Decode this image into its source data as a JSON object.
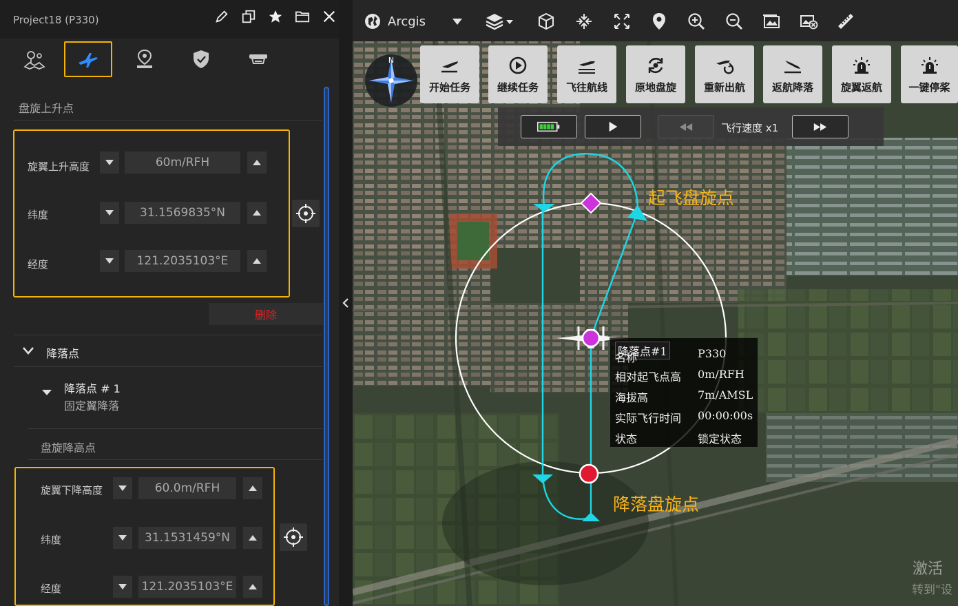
{
  "panel": {
    "project_title": "Project18 (P330)",
    "header_icons": [
      "pencil-icon",
      "duplicate-icon",
      "star-icon",
      "folder-icon",
      "close-icon"
    ],
    "tabs": [
      {
        "icon": "map-route-icon"
      },
      {
        "icon": "airplane-icon",
        "active": true
      },
      {
        "icon": "map-pin-icon"
      },
      {
        "icon": "shield-icon"
      },
      {
        "icon": "payload-icon"
      }
    ],
    "takeoff": {
      "section_title": "盘旋上升点",
      "rows": [
        {
          "label": "旋翼上升高度",
          "value": "60m/RFH"
        },
        {
          "label": "纬度",
          "value": "31.1569835°N"
        },
        {
          "label": "经度",
          "value": "121.2035103°E"
        }
      ],
      "delete_label": "删除"
    },
    "landing": {
      "section_title": "降落点",
      "item_title": "降落点 # 1",
      "item_subtitle": "固定翼降落",
      "sub_section_title": "盘旋降高点",
      "rows": [
        {
          "label": "旋翼下降高度",
          "value": "60.0m/RFH"
        },
        {
          "label": "纬度",
          "value": "31.1531459°N"
        },
        {
          "label": "经度",
          "value": "121.2035103°E"
        }
      ]
    }
  },
  "map": {
    "basemap": "Arcgis",
    "commands": [
      {
        "label": "开始任务",
        "icon": "takeoff-icon"
      },
      {
        "label": "继续任务",
        "icon": "resume-icon"
      },
      {
        "label": "飞往航线",
        "icon": "fly-route-icon"
      },
      {
        "label": "原地盘旋",
        "icon": "loiter-icon"
      },
      {
        "label": "重新出航",
        "icon": "redepart-icon"
      },
      {
        "label": "返航降落",
        "icon": "return-land-icon"
      },
      {
        "label": "旋翼返航",
        "icon": "rotor-return-icon"
      },
      {
        "label": "一键停桨",
        "icon": "stop-prop-icon"
      }
    ],
    "playback": {
      "speed_label": "飞行速度 x1",
      "battery_icon": "battery-icon"
    },
    "compass_letter": "N",
    "labels": {
      "takeoff_circle": "起飞盘旋点",
      "landing_circle": "降落盘旋点"
    },
    "info": {
      "title": "降落点#1",
      "rows": [
        {
          "k": "名称",
          "v": "P330"
        },
        {
          "k": "相对起飞点高",
          "v": "0m/RFH"
        },
        {
          "k": "海拔高",
          "v": "7m/AMSL"
        },
        {
          "k": "实际飞行时间",
          "v": "00:00:00s"
        },
        {
          "k": "状态",
          "v": "锁定状态"
        }
      ]
    },
    "watermark": [
      "激活",
      "转到\"设"
    ],
    "colors": {
      "accent": "#f5b400",
      "route": "#1ed6e6",
      "danger": "#e02020",
      "waypoint_takeoff": "#cc33dd",
      "waypoint_land": "#e01830"
    }
  }
}
